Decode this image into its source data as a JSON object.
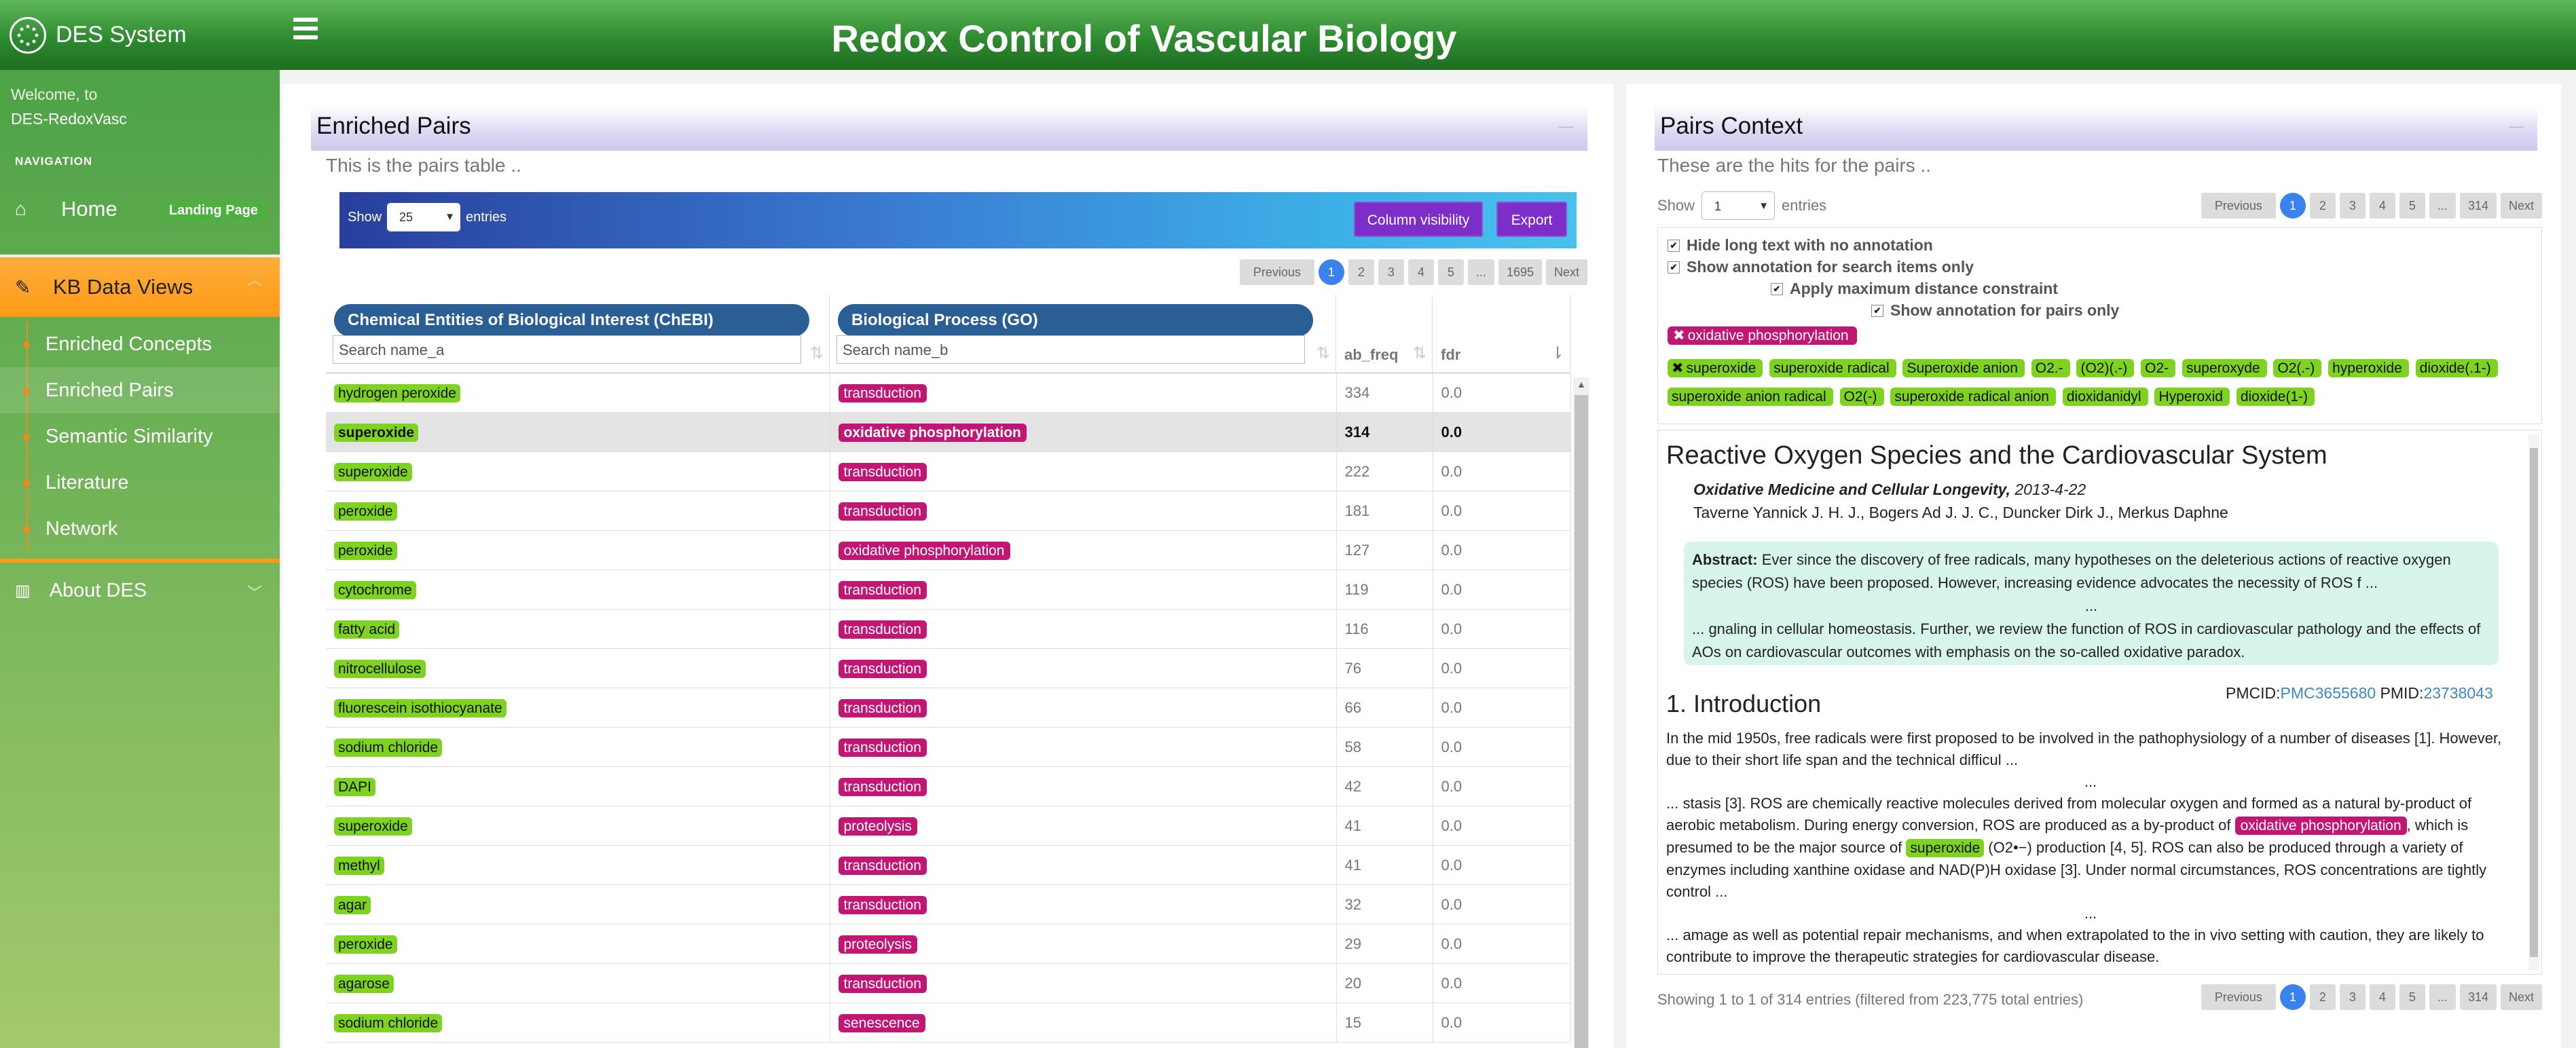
{
  "brand": {
    "name": "DES System"
  },
  "page_title": "Redox Control of Vascular Biology",
  "sidebar": {
    "welcome": "Welcome, to",
    "user": "DES-RedoxVasc",
    "nav_header": "NAVIGATION",
    "home": "Home",
    "landing_badge": "Landing Page",
    "kb": "KB Data Views",
    "sub_items": [
      "Enriched Concepts",
      "Enriched Pairs",
      "Semantic Similarity",
      "Literature",
      "Network"
    ],
    "about": "About DES"
  },
  "left_panel": {
    "title": "Enriched Pairs",
    "description": "This is the pairs table ..",
    "show_label": "Show",
    "show_value": "25",
    "entries_label": "entries",
    "column_visibility": "Column visibility",
    "export": "Export",
    "pager": [
      "Previous",
      "1",
      "2",
      "3",
      "4",
      "5",
      "...",
      "1695",
      "Next"
    ],
    "columns": {
      "a_header": "Chemical Entities of Biological Interest (ChEBI)",
      "a_placeholder": "Search name_a",
      "b_header": "Biological Process (GO)",
      "b_placeholder": "Search name_b",
      "freq": "ab_freq",
      "fdr": "fdr"
    },
    "rows": [
      [
        "hydrogen peroxide",
        "transduction",
        "334",
        "0.0"
      ],
      [
        "superoxide",
        "oxidative phosphorylation",
        "314",
        "0.0"
      ],
      [
        "superoxide",
        "transduction",
        "222",
        "0.0"
      ],
      [
        "peroxide",
        "transduction",
        "181",
        "0.0"
      ],
      [
        "peroxide",
        "oxidative phosphorylation",
        "127",
        "0.0"
      ],
      [
        "cytochrome",
        "transduction",
        "119",
        "0.0"
      ],
      [
        "fatty acid",
        "transduction",
        "116",
        "0.0"
      ],
      [
        "nitrocellulose",
        "transduction",
        "76",
        "0.0"
      ],
      [
        "fluorescein isothiocyanate",
        "transduction",
        "66",
        "0.0"
      ],
      [
        "sodium chloride",
        "transduction",
        "58",
        "0.0"
      ],
      [
        "DAPI",
        "transduction",
        "42",
        "0.0"
      ],
      [
        "superoxide",
        "proteolysis",
        "41",
        "0.0"
      ],
      [
        "methyl",
        "transduction",
        "41",
        "0.0"
      ],
      [
        "agar",
        "transduction",
        "32",
        "0.0"
      ],
      [
        "peroxide",
        "proteolysis",
        "29",
        "0.0"
      ],
      [
        "agarose",
        "transduction",
        "20",
        "0.0"
      ],
      [
        "sodium chloride",
        "senescence",
        "15",
        "0.0"
      ]
    ]
  },
  "right_panel": {
    "title": "Pairs Context",
    "description": "These are the hits for the pairs ..",
    "show_label": "Show",
    "show_value": "1",
    "entries_label": "entries",
    "pager": [
      "Previous",
      "1",
      "2",
      "3",
      "4",
      "5",
      "...",
      "314",
      "Next"
    ],
    "options": [
      "Hide long text with no annotation",
      "Show annotation for search items only",
      "Apply maximum distance constraint",
      "Show annotation for pairs only"
    ],
    "pair_tag": "oxidative phosphorylation",
    "synonym_tags": [
      "superoxide",
      "superoxide radical",
      "Superoxide anion",
      "O2.-",
      "(O2)(.-)",
      "O2-",
      "superoxyde",
      "O2(.-)",
      "hyperoxide",
      "dioxide(.1-)",
      "superoxide anion radical",
      "O2(-)",
      "superoxide radical anion",
      "dioxidanidyl",
      "Hyperoxid",
      "dioxide(1-)"
    ],
    "article": {
      "title": "Reactive Oxygen Species and the Cardiovascular System",
      "journal": "Oxidative Medicine and Cellular Longevity,",
      "date": " 2013-4-22",
      "authors": "Taverne Yannick J. H. J., Bogers Ad J. J. C., Duncker Dirk J., Merkus Daphne",
      "abstract_label": "Abstract:",
      "abstract_1": " Ever since the discovery of free radicals, many hypotheses on the deleterious actions of reactive oxygen species (ROS) have been proposed. However, increasing evidence advocates the necessity of ROS f ...",
      "ellipsis": "...",
      "abstract_2": "... gnaling in cellular homeostasis. Further, we review the function of ROS in cardiovascular pathology and the effects of AOs on cardiovascular outcomes with emphasis on the so-called oxidative paradox.",
      "pmcid_label": "PMCID:",
      "pmcid": "PMC3655680",
      "pmid_label": " PMID:",
      "pmid": "23738043",
      "intro_heading": "1. Introduction",
      "para1": "In the mid 1950s, free radicals were first proposed to be involved in the pathophysiology of a number of diseases [1]. However, due to their short life span and the technical difficul ...",
      "para2_a": "... stasis [3]. ROS are chemically reactive molecules derived from molecular oxygen and formed as a natural by-product of aerobic metabolism. During energy conversion, ROS are produced as a by-product of ",
      "para2_tag1": "oxidative phosphorylation",
      "para2_b": ", which is presumed to be the major source of ",
      "para2_tag2": "superoxide",
      "para2_c": " (O2•−) production [4, 5]. ROS can also be produced through a variety of enzymes including xanthine oxidase and NAD(P)H oxidase [3]. Under normal circumstances, ROS concentrations are tightly control ...",
      "para3": "... amage as well as potential repair mechanisms, and when extrapolated to the in vivo setting with caution, they are likely to contribute to improve the therapeutic strategies for cardiovascular disease."
    },
    "footer": "Showing 1 to 1 of 314 entries (filtered from 223,775 total entries)"
  }
}
